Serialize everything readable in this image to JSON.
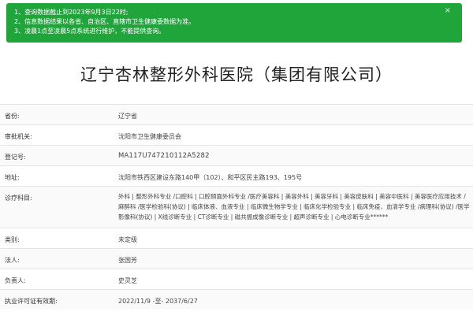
{
  "notice": {
    "lines": [
      "1、查询数据截止到2023年9月3日22时;",
      "2、信息数据结果以各省、自治区、直辖市卫生健康委数据为准。",
      "3、凌晨1点至凌晨5点系统进行维护，不能提供查询。"
    ],
    "close_glyph": "×",
    "bg_color": "#1fa53a"
  },
  "title": "辽宁杏林整形外科医院（集团有限公司）",
  "rows": [
    {
      "label": "省份:",
      "value": "辽宁省"
    },
    {
      "label": "审批机关:",
      "value": "沈阳市卫生健康委员会"
    },
    {
      "label": "登记号:",
      "value": "MA117U747210112A5282"
    },
    {
      "label": "地址:",
      "value": "沈阳市铁西区建设东路140甲（102）、和平区民主路193、195号"
    },
    {
      "label": "诊疗科目:",
      "value": "外科 | 整形外科专业 /口腔科 | 口腔颌面外科专业 /医疗美容科 | 美容外科 | 美容牙科 | 美容皮肤科 | 美容中医科 | 美容医疗应用技术 /麻醉科 /医学检验科(协议) | 临床体液、血液专业 | 临床微生物学专业 | 临床化学检验专业 | 临床免疫、血清学专业 /病理科(协议) /医学影像科(协议) | X线诊断专业 | CT诊断专业 | 磁共振成像诊断专业 | 超声诊断专业 | 心电诊断专业******"
    },
    {
      "label": "类别:",
      "value": "未定级"
    },
    {
      "label": "法人:",
      "value": "张国芳"
    },
    {
      "label": "负责人:",
      "value": "史灵芝"
    },
    {
      "label": "执业许可证有效期:",
      "value": "2022/11/9 -至- 2037/6/27"
    }
  ]
}
